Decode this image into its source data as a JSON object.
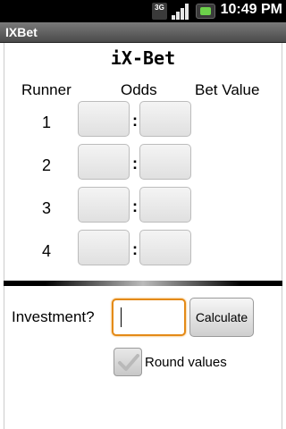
{
  "status_bar": {
    "network": "3G",
    "time": "10:49 PM"
  },
  "app": {
    "window_title": "IXBet",
    "heading": "iX-Bet"
  },
  "table": {
    "headers": [
      "Runner",
      "Odds",
      "Bet Value"
    ],
    "runners": [
      "1",
      "2",
      "3",
      "4"
    ],
    "separator": ":"
  },
  "investment": {
    "label": "Investment?",
    "value": "",
    "calculate_label": "Calculate"
  },
  "options": {
    "round_values_label": "Round values",
    "round_values_checked": true
  },
  "colors": {
    "focus": "#e48a17",
    "titlebar": "#5a5a5a",
    "battery_charge": "#6cd14a"
  }
}
